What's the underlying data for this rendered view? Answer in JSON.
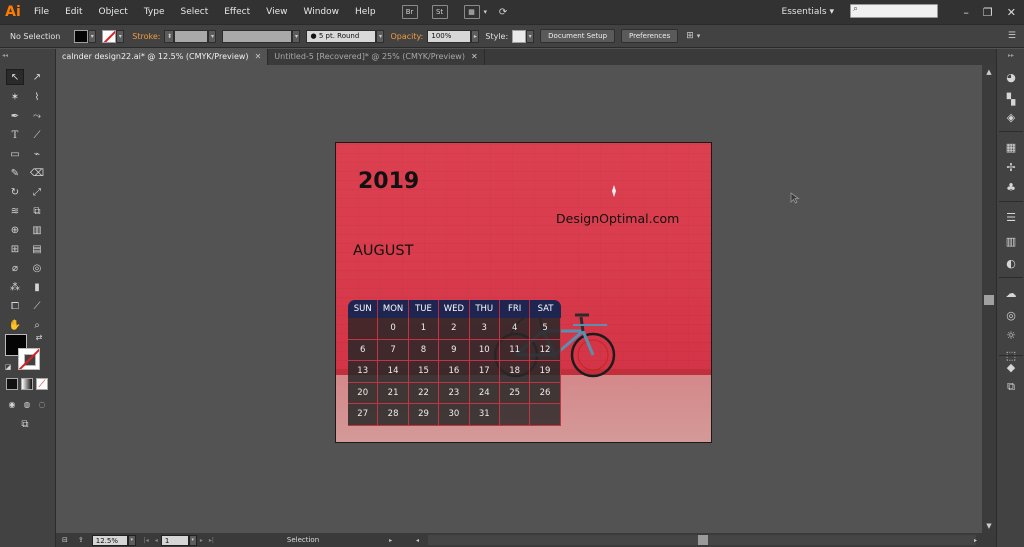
{
  "app": {
    "logo": "Ai"
  },
  "menu": [
    "File",
    "Edit",
    "Object",
    "Type",
    "Select",
    "Effect",
    "View",
    "Window",
    "Help"
  ],
  "menubar": {
    "bridge_icon": "Br",
    "stock_icon": "St",
    "workspace": "Essentials"
  },
  "control": {
    "selection_label": "No Selection",
    "stroke_label": "Stroke:",
    "brush_value": "5 pt. Round",
    "opacity_label": "Opacity:",
    "opacity_value": "100%",
    "style_label": "Style:",
    "document_setup": "Document Setup",
    "preferences": "Preferences"
  },
  "tabs": [
    {
      "label": "calnder design22.ai* @ 12.5% (CMYK/Preview)",
      "active": true
    },
    {
      "label": "Untitled-5 [Recovered]* @ 25% (CMYK/Preview)",
      "active": false
    }
  ],
  "status": {
    "zoom": "12.5%",
    "artboard": "1",
    "tool": "Selection"
  },
  "artwork": {
    "year": "2019",
    "brand": "DesignOptimal.com",
    "month": "AUGUST",
    "weekdays": [
      "SUN",
      "MON",
      "TUE",
      "WED",
      "THU",
      "FRI",
      "SAT"
    ],
    "days": [
      "",
      "0",
      "1",
      "2",
      "3",
      "4",
      "5",
      "6",
      "7",
      "8",
      "9",
      "10",
      "11",
      "12",
      "13",
      "14",
      "15",
      "16",
      "17",
      "18",
      "19",
      "20",
      "21",
      "22",
      "23",
      "24",
      "25",
      "26",
      "27",
      "28",
      "29",
      "30",
      "31",
      "",
      ""
    ]
  },
  "colors": {
    "accent": "#ff7c00",
    "calendar_header": "#1e2550",
    "wall": "#d93c4c"
  }
}
